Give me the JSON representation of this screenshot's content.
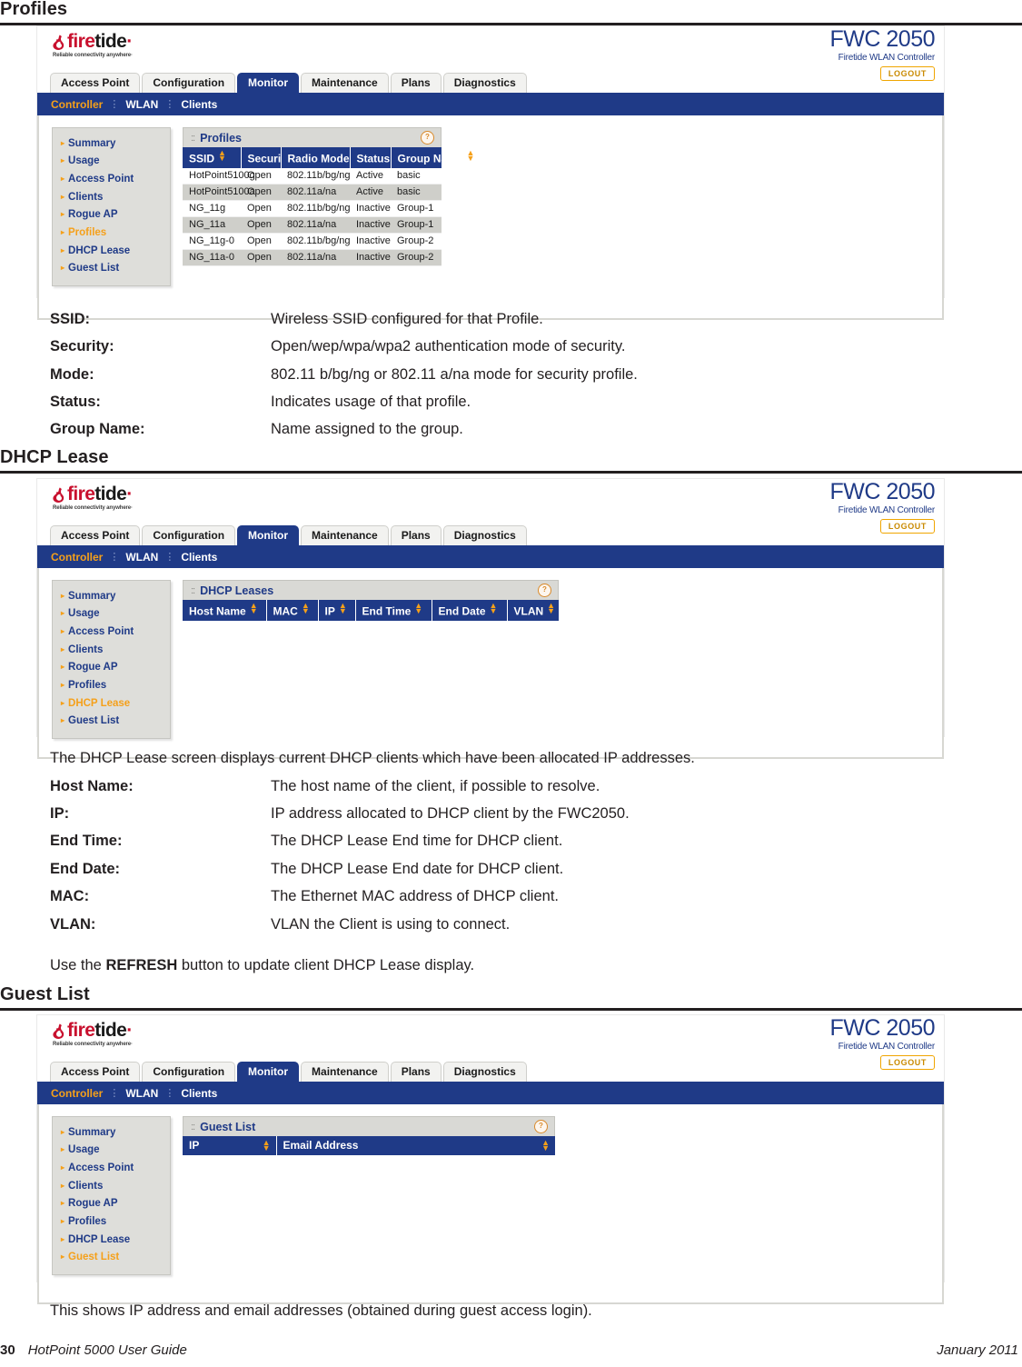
{
  "page": {
    "footer_page_number": "30",
    "footer_title": "HotPoint 5000 User Guide",
    "footer_date": "January 2011"
  },
  "sections": {
    "profiles": {
      "heading": "Profiles",
      "definitions": [
        {
          "term": "SSID:",
          "desc": "Wireless SSID configured for that Profile."
        },
        {
          "term": "Security:",
          "desc": "Open/wep/wpa/wpa2 authentication mode of security."
        },
        {
          "term": "Mode:",
          "desc": "802.11 b/bg/ng or 802.11 a/na mode for security profile."
        },
        {
          "term": "Status:",
          "desc": "Indicates usage of that profile."
        },
        {
          "term": "Group Name:",
          "desc": "Name assigned to the group."
        }
      ]
    },
    "dhcp": {
      "heading": "DHCP Lease",
      "intro": "The DHCP Lease screen displays current DHCP clients which have been allocated IP addresses.",
      "definitions": [
        {
          "term": "Host Name:",
          "desc": "The host name of the client, if possible to resolve."
        },
        {
          "term": "IP:",
          "desc": "IP address allocated to DHCP client by the FWC2050."
        },
        {
          "term": "End Time:",
          "desc": "The DHCP Lease End time for DHCP client."
        },
        {
          "term": "End Date:",
          "desc": "The DHCP Lease End date for DHCP client."
        },
        {
          "term": "MAC:",
          "desc": "The Ethernet MAC address of DHCP client."
        },
        {
          "term": "VLAN:",
          "desc": "VLAN the Client is using to connect."
        }
      ],
      "refresh_note_before": "Use the ",
      "refresh_note_bold": "REFRESH",
      "refresh_note_after": " button to update client DHCP Lease display."
    },
    "guest": {
      "heading": "Guest List",
      "note": "This shows IP address and email addresses (obtained during guest access login)."
    }
  },
  "app": {
    "logo": {
      "word_first": "fire",
      "word_second": "tide",
      "trademark": "·",
      "tagline": "Reliable connectivity anywhere·"
    },
    "product": {
      "name": "FWC 2050",
      "subtitle": "Firetide WLAN Controller",
      "logout": "LOGOUT"
    },
    "tabs": [
      {
        "label": "Access Point",
        "active": false
      },
      {
        "label": "Configuration",
        "active": false
      },
      {
        "label": "Monitor",
        "active": true
      },
      {
        "label": "Maintenance",
        "active": false
      },
      {
        "label": "Plans",
        "active": false
      },
      {
        "label": "Diagnostics",
        "active": false
      }
    ],
    "breadcrumb": [
      {
        "label": "Controller",
        "active": true
      },
      {
        "label": "WLAN",
        "active": false
      },
      {
        "label": "Clients",
        "active": false
      }
    ],
    "breadcrumb_separator": "⋮",
    "sidebar_items": [
      "Summary",
      "Usage",
      "Access Point",
      "Clients",
      "Rogue AP",
      "Profiles",
      "DHCP Lease",
      "Guest List"
    ],
    "help_icon_glyph": "?",
    "panel_grip_glyph": "::"
  },
  "screens": {
    "profiles": {
      "active_sidebar": "Profiles",
      "panel_title": "Profiles",
      "columns": [
        "SSID",
        "Security",
        "Radio Mode",
        "Status",
        "Group Name"
      ],
      "rows": [
        [
          "HotPoint5100g",
          "Open",
          "802.11b/bg/ng",
          "Active",
          "basic"
        ],
        [
          "HotPoint5100a",
          "Open",
          "802.11a/na",
          "Active",
          "basic"
        ],
        [
          "NG_11g",
          "Open",
          "802.11b/bg/ng",
          "Inactive",
          "Group-1"
        ],
        [
          "NG_11a",
          "Open",
          "802.11a/na",
          "Inactive",
          "Group-1"
        ],
        [
          "NG_11g-0",
          "Open",
          "802.11b/bg/ng",
          "Inactive",
          "Group-2"
        ],
        [
          "NG_11a-0",
          "Open",
          "802.11a/na",
          "Inactive",
          "Group-2"
        ]
      ]
    },
    "dhcp": {
      "active_sidebar": "DHCP Lease",
      "panel_title": "DHCP Leases",
      "columns": [
        "Host Name",
        "MAC",
        "IP",
        "End Time",
        "End Date",
        "VLAN"
      ],
      "rows": []
    },
    "guest": {
      "active_sidebar": "Guest List",
      "panel_title": "Guest List",
      "columns": [
        "IP",
        "Email Address"
      ],
      "rows": []
    }
  },
  "colors": {
    "navy": "#1f3a87",
    "orange": "#f5a01a",
    "brand_red": "#c8102e",
    "text": "#231f20"
  }
}
